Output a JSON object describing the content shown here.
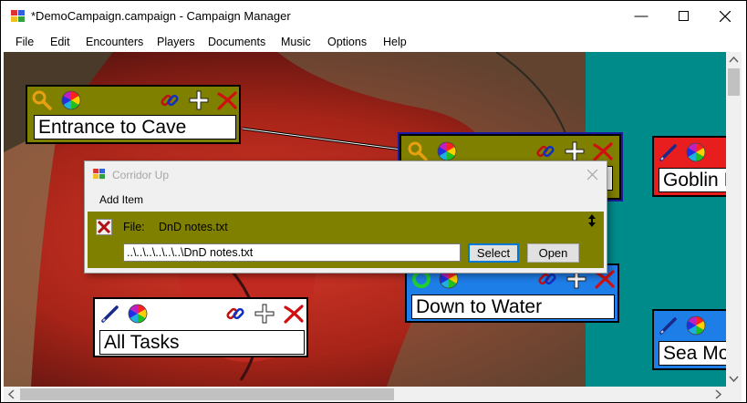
{
  "window": {
    "title": "*DemoCampaign.campaign - Campaign Manager",
    "controls": {
      "minimize": "minimize-icon",
      "maximize": "maximize-icon",
      "close": "close-icon"
    }
  },
  "menu": [
    "File",
    "Edit",
    "Encounters",
    "Players",
    "Documents",
    "Music",
    "Options",
    "Help"
  ],
  "nodes": {
    "entrance": {
      "title": "Entrance to Cave",
      "color": "#808000"
    },
    "corridor": {
      "color": "#808000"
    },
    "goblin": {
      "title": "Goblin I",
      "color": "#e81e1e"
    },
    "down_to_water": {
      "title": "Down to Water",
      "color": "#1e7ee8"
    },
    "all_tasks": {
      "title": "All Tasks",
      "color": "#ffffff"
    },
    "sea": {
      "title": "Sea Mo",
      "color": "#1e7ee8"
    }
  },
  "dialog": {
    "title": "Corridor Up",
    "menu_item": "Add Item",
    "item": {
      "file_label": "File:",
      "file_name": "DnD notes.txt",
      "path": "..\\..\\..\\..\\..\\..\\DnD notes.txt",
      "select_label": "Select",
      "open_label": "Open"
    }
  },
  "colors": {
    "teal_area": "#008b8b",
    "olive": "#808000",
    "red_node": "#e81e1e",
    "blue_node": "#1e7ee8"
  }
}
